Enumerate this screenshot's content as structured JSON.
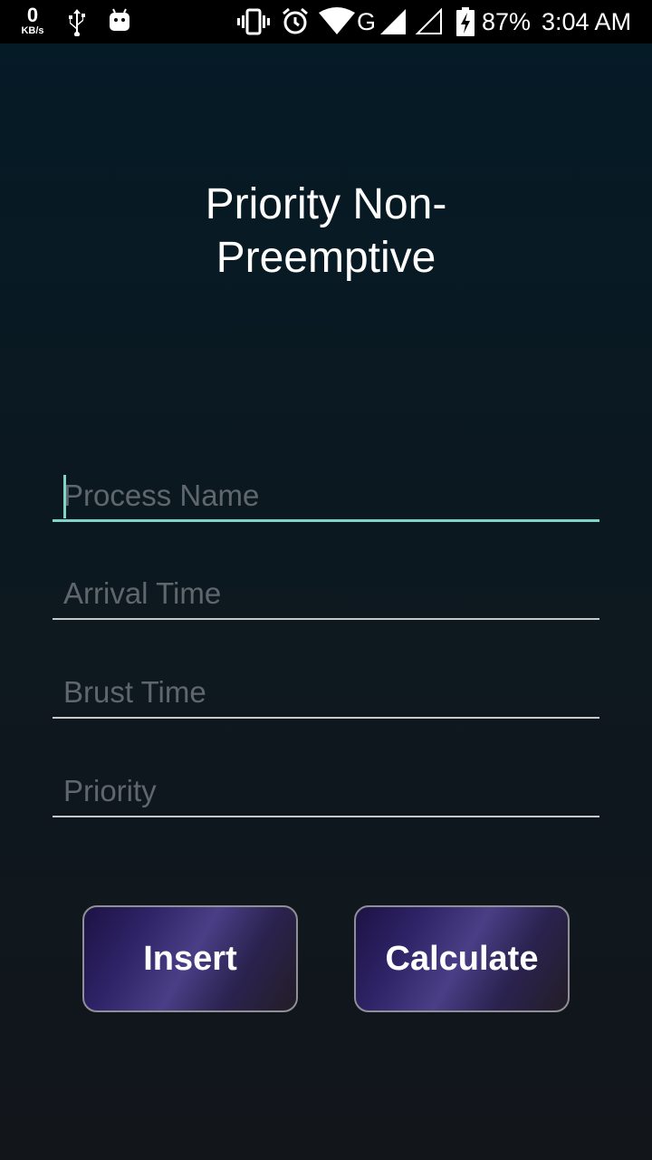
{
  "status_bar": {
    "net_speed_value": "0",
    "net_speed_unit": "KB/s",
    "network_label": "G",
    "battery": "87%",
    "time": "3:04 AM",
    "icons": [
      "usb-icon",
      "android-debug-icon",
      "vibrate-icon",
      "alarm-icon",
      "wifi-icon",
      "signal-icon",
      "signal-empty-icon",
      "battery-charging-icon"
    ]
  },
  "title": {
    "line1": "Priority Non-",
    "line2": "Preemptive"
  },
  "form": {
    "process_name": {
      "placeholder": "Process Name",
      "value": ""
    },
    "arrival_time": {
      "placeholder": "Arrival Time",
      "value": ""
    },
    "burst_time": {
      "placeholder": "Brust Time",
      "value": ""
    },
    "priority": {
      "placeholder": "Priority",
      "value": ""
    }
  },
  "buttons": {
    "insert_label": "Insert",
    "calculate_label": "Calculate"
  },
  "colors": {
    "accent": "#7fd3c7",
    "background_top": "#041b27",
    "background_bottom": "#12161b",
    "button_gradient_mid": "#4a3e86"
  }
}
